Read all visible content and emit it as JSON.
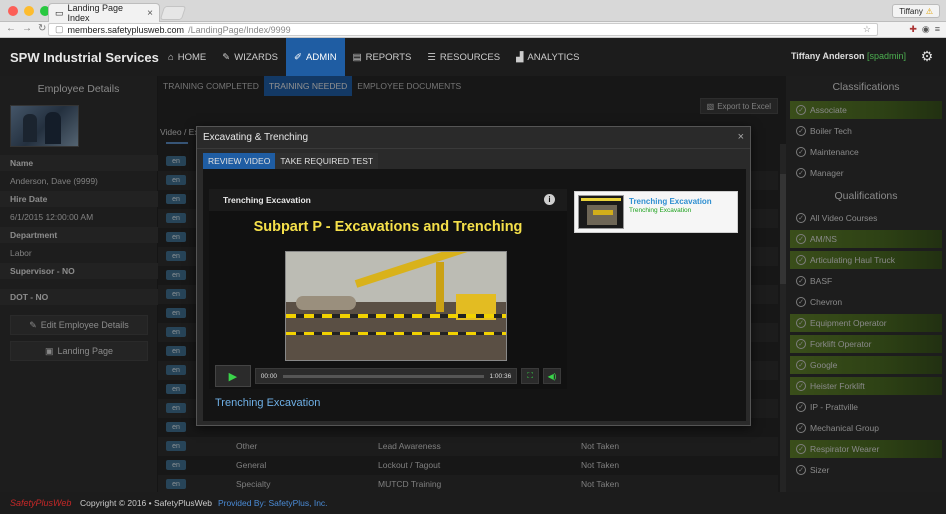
{
  "browser": {
    "tab_title": "Landing Page Index",
    "user_chip": "Tiffany",
    "url_host": "members.safetyplusweb.com",
    "url_path": "/LandingPage/Index/9999"
  },
  "app": {
    "brand": "SPW Industrial Services",
    "nav": [
      "HOME",
      "WIZARDS",
      "ADMIN",
      "REPORTS",
      "RESOURCES",
      "ANALYTICS"
    ],
    "active_nav": "ADMIN",
    "user_name": "Tiffany Anderson",
    "user_role": "[spadmin]"
  },
  "employee": {
    "title": "Employee Details",
    "name_label": "Name",
    "name_value": "Anderson, Dave (9999)",
    "hire_label": "Hire Date",
    "hire_value": "6/1/2015 12:00:00 AM",
    "dept_label": "Department",
    "dept_value": "Labor",
    "supervisor": "Supervisor - NO",
    "dot": "DOT - NO",
    "edit_button": "Edit Employee Details",
    "landing_button": "Landing Page"
  },
  "center": {
    "subtabs": [
      "TRAINING COMPLETED",
      "TRAINING NEEDED",
      "EMPLOYEE DOCUMENTS"
    ],
    "active_subtab": "TRAINING NEEDED",
    "export_label": "Export to Excel",
    "content_tab": "Video / Ex",
    "badge": "en",
    "rows": [
      {
        "category": "Other",
        "course": "Lead Awareness",
        "status": "Not Taken"
      },
      {
        "category": "General",
        "course": "Lockout / Tagout",
        "status": "Not Taken"
      },
      {
        "category": "Specialty",
        "course": "MUTCD Training",
        "status": "Not Taken"
      }
    ]
  },
  "classifications": {
    "title": "Classifications",
    "items": [
      {
        "label": "Associate",
        "checked": true
      },
      {
        "label": "Boiler Tech",
        "checked": false
      },
      {
        "label": "Maintenance",
        "checked": false
      },
      {
        "label": "Manager",
        "checked": false
      }
    ]
  },
  "qualifications": {
    "title": "Qualifications",
    "items": [
      {
        "label": "All Video Courses",
        "checked": false
      },
      {
        "label": "AM/NS",
        "checked": true
      },
      {
        "label": "Articulating Haul Truck",
        "checked": true
      },
      {
        "label": "BASF",
        "checked": false
      },
      {
        "label": "Chevron",
        "checked": false
      },
      {
        "label": "Equipment Operator",
        "checked": true
      },
      {
        "label": "Forklift Operator",
        "checked": true
      },
      {
        "label": "Google",
        "checked": true
      },
      {
        "label": "Heister Forklift",
        "checked": true
      },
      {
        "label": "IP - Prattville",
        "checked": false
      },
      {
        "label": "Mechanical Group",
        "checked": false
      },
      {
        "label": "Respirator Wearer",
        "checked": true
      },
      {
        "label": "Sizer",
        "checked": false
      }
    ]
  },
  "modal": {
    "title": "Excavating & Trenching",
    "tabs": [
      "REVIEW VIDEO",
      "TAKE REQUIRED TEST"
    ],
    "active_tab": "REVIEW VIDEO",
    "video_title": "Trenching Excavation",
    "headline": "Subpart P - Excavations and Trenching",
    "time_current": "00:00",
    "time_total": "1:00:36",
    "caption": "Trenching Excavation",
    "playlist_title": "Trenching Excavation",
    "playlist_sub": "Trenching Excavation"
  },
  "footer": {
    "logo": "SafetyPlusWeb",
    "copyright": "Copyright © 2016 • SafetyPlusWeb",
    "provided": "Provided By: SafetyPlus, Inc."
  },
  "colors": {
    "accent": "#1f5da3",
    "checked_bg": "#5e7e2b",
    "headline": "#f5e04a"
  }
}
